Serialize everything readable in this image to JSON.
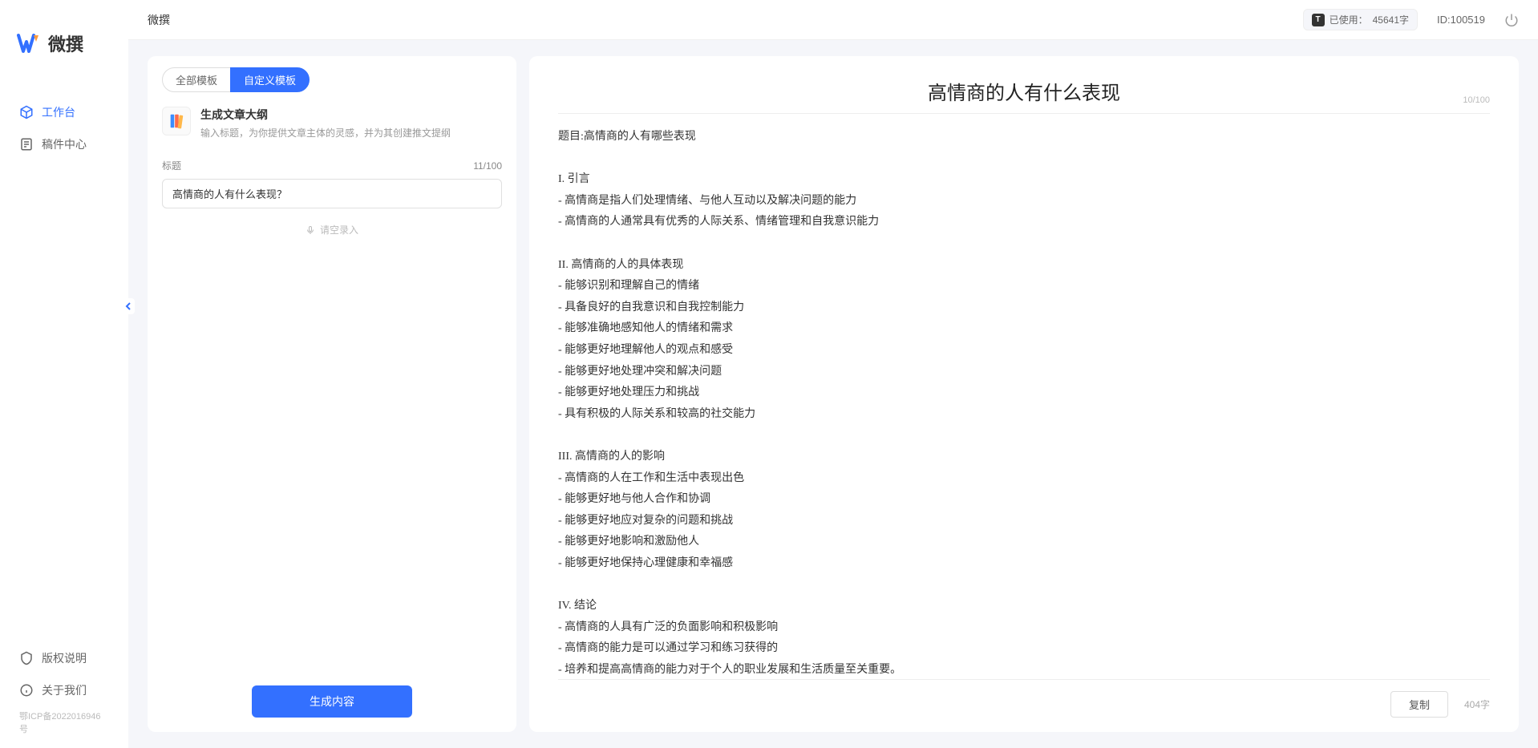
{
  "logo": {
    "text": "微撰"
  },
  "sidebar": {
    "nav": [
      {
        "label": "工作台",
        "active": true
      },
      {
        "label": "稿件中心",
        "active": false
      }
    ],
    "footer": [
      {
        "label": "版权说明"
      },
      {
        "label": "关于我们"
      }
    ],
    "icp": "鄂ICP备2022016946号"
  },
  "topbar": {
    "breadcrumb": "微撰",
    "usage_label": "已使用：",
    "usage_value": "45641字",
    "user_id": "ID:100519"
  },
  "left_panel": {
    "tabs": [
      {
        "label": "全部模板",
        "active": false
      },
      {
        "label": "自定义模板",
        "active": true
      }
    ],
    "template": {
      "title": "生成文章大纲",
      "desc": "输入标题，为你提供文章主体的灵感，并为其创建推文提纲"
    },
    "form": {
      "label": "标题",
      "counter": "11/100",
      "value": "高情商的人有什么表现？",
      "voice_hint": "请空录入"
    },
    "generate_button": "生成内容"
  },
  "right_panel": {
    "title": "高情商的人有什么表现",
    "title_counter": "10/100",
    "content": "题目:高情商的人有哪些表现\n\nI. 引言\n- 高情商是指人们处理情绪、与他人互动以及解决问题的能力\n- 高情商的人通常具有优秀的人际关系、情绪管理和自我意识能力\n\nII. 高情商的人的具体表现\n- 能够识别和理解自己的情绪\n- 具备良好的自我意识和自我控制能力\n- 能够准确地感知他人的情绪和需求\n- 能够更好地理解他人的观点和感受\n- 能够更好地处理冲突和解决问题\n- 能够更好地处理压力和挑战\n- 具有积极的人际关系和较高的社交能力\n\nIII. 高情商的人的影响\n- 高情商的人在工作和生活中表现出色\n- 能够更好地与他人合作和协调\n- 能够更好地应对复杂的问题和挑战\n- 能够更好地影响和激励他人\n- 能够更好地保持心理健康和幸福感\n\nIV. 结论\n- 高情商的人具有广泛的负面影响和积极影响\n- 高情商的能力是可以通过学习和练习获得的\n- 培养和提高高情商的能力对于个人的职业发展和生活质量至关重要。",
    "copy_button": "复制",
    "word_count": "404字"
  }
}
